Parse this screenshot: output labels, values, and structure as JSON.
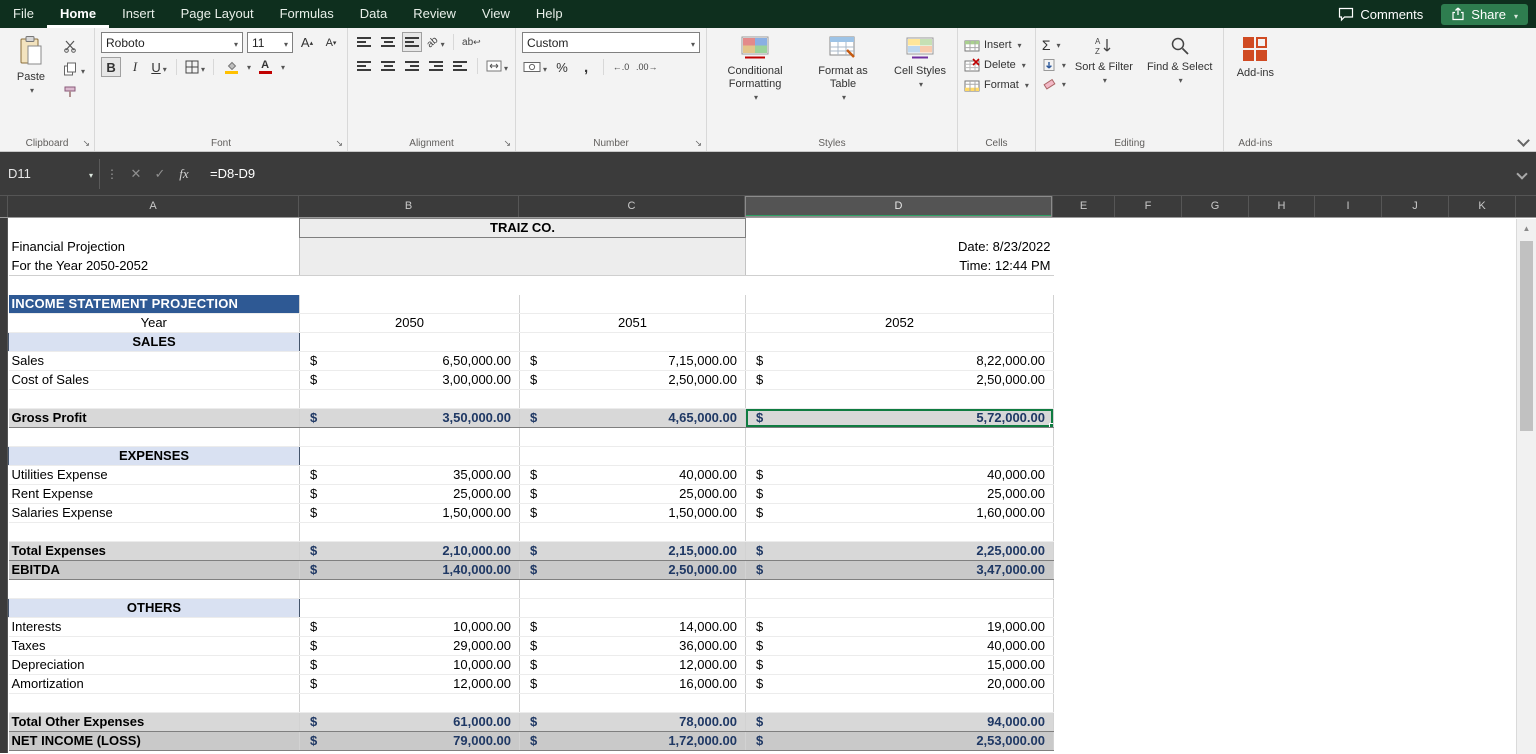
{
  "titlebar": {
    "tabs": [
      "File",
      "Home",
      "Insert",
      "Page Layout",
      "Formulas",
      "Data",
      "Review",
      "View",
      "Help"
    ],
    "active_tab": "Home",
    "comments_label": "Comments",
    "share_label": "Share"
  },
  "ribbon": {
    "clipboard": {
      "label": "Clipboard",
      "paste_label": "Paste"
    },
    "font": {
      "label": "Font",
      "font_name": "Roboto",
      "font_size": "11"
    },
    "alignment": {
      "label": "Alignment"
    },
    "number": {
      "label": "Number",
      "format": "Custom"
    },
    "styles": {
      "label": "Styles",
      "conditional_formatting": "Conditional Formatting",
      "format_as_table": "Format as Table",
      "cell_styles": "Cell Styles"
    },
    "cells": {
      "label": "Cells",
      "insert": "Insert",
      "delete": "Delete",
      "format": "Format"
    },
    "editing": {
      "label": "Editing",
      "sort_filter": "Sort & Filter",
      "find_select": "Find & Select"
    },
    "addins": {
      "label": "Add-ins",
      "button_label": "Add-ins"
    }
  },
  "glyphs": {
    "bold": "B",
    "italic": "I",
    "underline": "U",
    "percent": "%",
    "comma": ",",
    "increase_decimal": "←.0",
    "decrease_decimal": ".00→",
    "autosum": "Σ",
    "fx": "fx",
    "grow_font": "A",
    "shrink_font": "A",
    "wrap_text": "ab",
    "orientation": "ab"
  },
  "formula_bar": {
    "name_box": "D11",
    "formula": "=D8-D9"
  },
  "sheet": {
    "columns": [
      "A",
      "B",
      "C",
      "D",
      "E",
      "F",
      "G",
      "H",
      "I",
      "J",
      "K"
    ],
    "selected_column": "D",
    "selected_cell": "D11",
    "currency": "$",
    "rows": [
      {
        "type": "title",
        "text": "TRAIZ CO."
      },
      {
        "type": "plain",
        "a": "Financial Projection",
        "d": "Date: 8/23/2022"
      },
      {
        "type": "plain",
        "a": "For the Year 2050-2052",
        "d": "Time: 12:44 PM",
        "divider": true
      },
      {
        "type": "blank",
        "zone": "top"
      },
      {
        "type": "banner",
        "a": "INCOME STATEMENT PROJECTION"
      },
      {
        "type": "year",
        "a": "Year",
        "b": "2050",
        "c": "2051",
        "d": "2052"
      },
      {
        "type": "subheader",
        "a": "SALES"
      },
      {
        "type": "data",
        "a": "Sales",
        "b": "6,50,000.00",
        "c": "7,15,000.00",
        "d": "8,22,000.00"
      },
      {
        "type": "data",
        "a": "Cost of Sales",
        "b": "3,00,000.00",
        "c": "2,50,000.00",
        "d": "2,50,000.00"
      },
      {
        "type": "blank"
      },
      {
        "type": "total",
        "a": "Gross Profit",
        "b": "3,50,000.00",
        "c": "4,65,000.00",
        "d": "5,72,000.00",
        "selected": "d"
      },
      {
        "type": "blank"
      },
      {
        "type": "subheader",
        "a": "EXPENSES"
      },
      {
        "type": "data",
        "a": "Utilities Expense",
        "b": "35,000.00",
        "c": "40,000.00",
        "d": "40,000.00"
      },
      {
        "type": "data",
        "a": "Rent Expense",
        "b": "25,000.00",
        "c": "25,000.00",
        "d": "25,000.00"
      },
      {
        "type": "data",
        "a": "Salaries Expense",
        "b": "1,50,000.00",
        "c": "1,50,000.00",
        "d": "1,60,000.00"
      },
      {
        "type": "blank"
      },
      {
        "type": "total",
        "a": "Total Expenses",
        "b": "2,10,000.00",
        "c": "2,15,000.00",
        "d": "2,25,000.00"
      },
      {
        "type": "total2",
        "a": "EBITDA",
        "b": "1,40,000.00",
        "c": "2,50,000.00",
        "d": "3,47,000.00"
      },
      {
        "type": "blank"
      },
      {
        "type": "subheader",
        "a": "OTHERS"
      },
      {
        "type": "data",
        "a": "Interests",
        "b": "10,000.00",
        "c": "14,000.00",
        "d": "19,000.00"
      },
      {
        "type": "data",
        "a": "Taxes",
        "b": "29,000.00",
        "c": "36,000.00",
        "d": "40,000.00"
      },
      {
        "type": "data",
        "a": "Depreciation",
        "b": "10,000.00",
        "c": "12,000.00",
        "d": "15,000.00"
      },
      {
        "type": "data",
        "a": "Amortization",
        "b": "12,000.00",
        "c": "16,000.00",
        "d": "20,000.00"
      },
      {
        "type": "blank"
      },
      {
        "type": "total",
        "a": "Total Other Expenses",
        "b": "61,000.00",
        "c": "78,000.00",
        "d": "94,000.00"
      },
      {
        "type": "total2",
        "a": "NET INCOME (LOSS)",
        "b": "79,000.00",
        "c": "1,72,000.00",
        "d": "2,53,000.00"
      }
    ]
  },
  "colors": {
    "selection_green": "#107C41",
    "banner_blue": "#2E5994",
    "subheader_fill": "#D9E1F2",
    "total_number_text": "#1F3864",
    "titlebar_green": "#0E2F1E"
  }
}
